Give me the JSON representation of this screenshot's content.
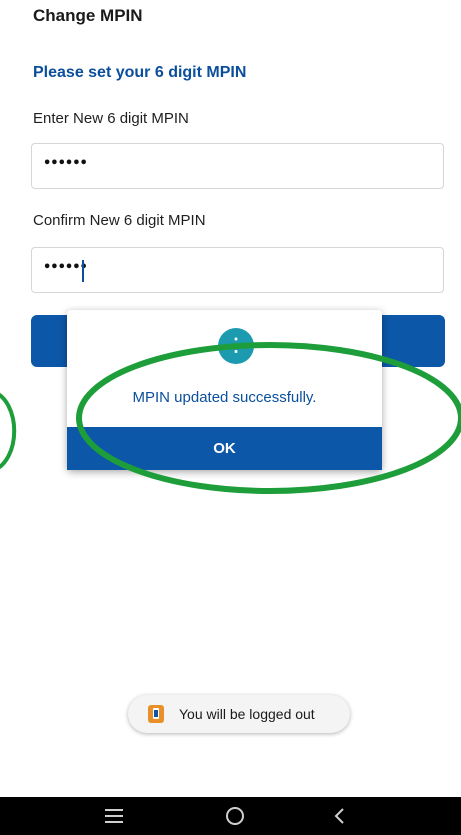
{
  "header": {
    "title": "Change MPIN"
  },
  "form": {
    "heading": "Please set your 6 digit MPIN",
    "new_label": "Enter New 6 digit MPIN",
    "new_value": "••••••",
    "confirm_label": "Confirm New 6 digit MPIN",
    "confirm_value": "••••••"
  },
  "dialog": {
    "message": "MPIN updated successfully.",
    "ok_label": "OK",
    "icon": "info-icon"
  },
  "toast": {
    "text": "You will be logged out",
    "icon": "app-icon"
  },
  "nav": {
    "icons": [
      "recents-icon",
      "home-icon",
      "back-icon"
    ]
  },
  "colors": {
    "brand_blue": "#0c57a8",
    "heading_blue": "#0b4f9c",
    "info_teal": "#1c9ab0",
    "annotation_green": "#1e9e3a"
  }
}
